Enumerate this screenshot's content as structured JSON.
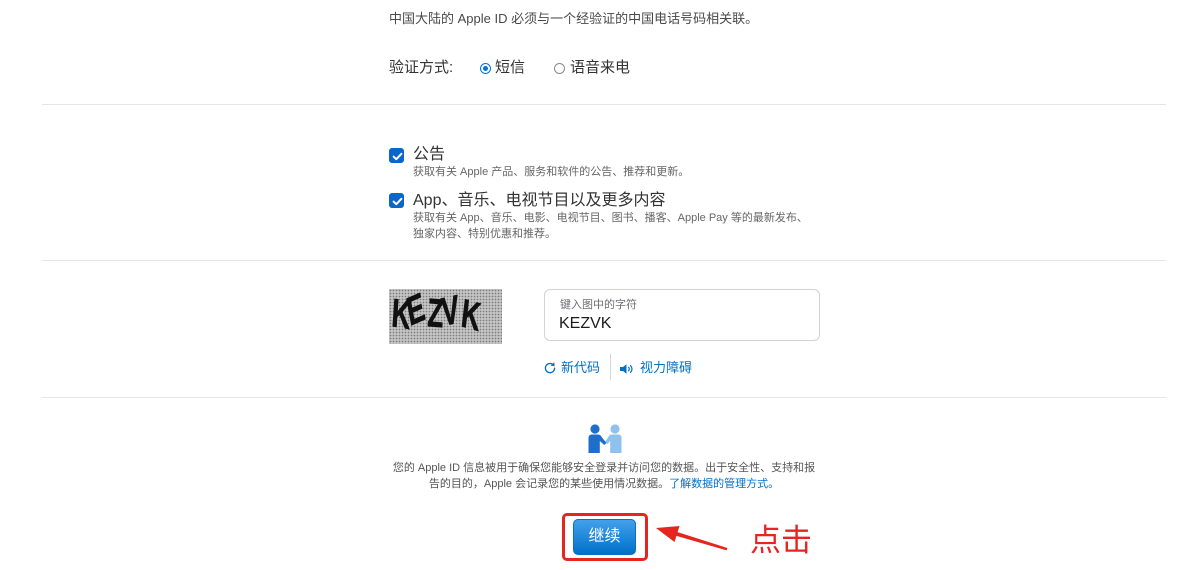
{
  "notice": "中国大陆的 Apple ID 必须与一个经验证的中国电话号码相关联。",
  "verification": {
    "label": "验证方式:",
    "options": [
      {
        "label": "短信",
        "selected": true
      },
      {
        "label": "语音来电",
        "selected": false
      }
    ]
  },
  "subscriptions": [
    {
      "title": "公告",
      "checked": true,
      "description_lines": [
        "获取有关 Apple 产品、服务和软件的公告、推荐和更新。"
      ]
    },
    {
      "title": "App、音乐、电视节目以及更多内容",
      "checked": true,
      "description_lines": [
        "获取有关 App、音乐、电影、电视节目、图书、播客、Apple Pay 等的最新发布、",
        "独家内容、特别优惠和推荐。"
      ]
    }
  ],
  "captcha": {
    "image_text": "KEZVK",
    "field_label": "键入图中的字符",
    "field_value": "KEZVK",
    "new_code_label": "新代码",
    "vision_impaired_label": "视力障碍"
  },
  "privacy": {
    "line1": "您的 Apple ID 信息被用于确保您能够安全登录并访问您的数据。出于安全性、支持和报",
    "line2": "告的目的，Apple 会记录您的某些使用情况数据。",
    "link": "了解数据的管理方式。"
  },
  "actions": {
    "continue_label": "继续"
  },
  "annotation": {
    "label": "点击"
  },
  "icons": {
    "checkbox": "checkmark-icon",
    "refresh": "refresh-icon",
    "speaker": "speaker-icon",
    "privacy": "handshake-icon",
    "pointer": "arrow-icon"
  },
  "colors": {
    "accent": "#0070c9",
    "annotation": "#e5261f"
  }
}
